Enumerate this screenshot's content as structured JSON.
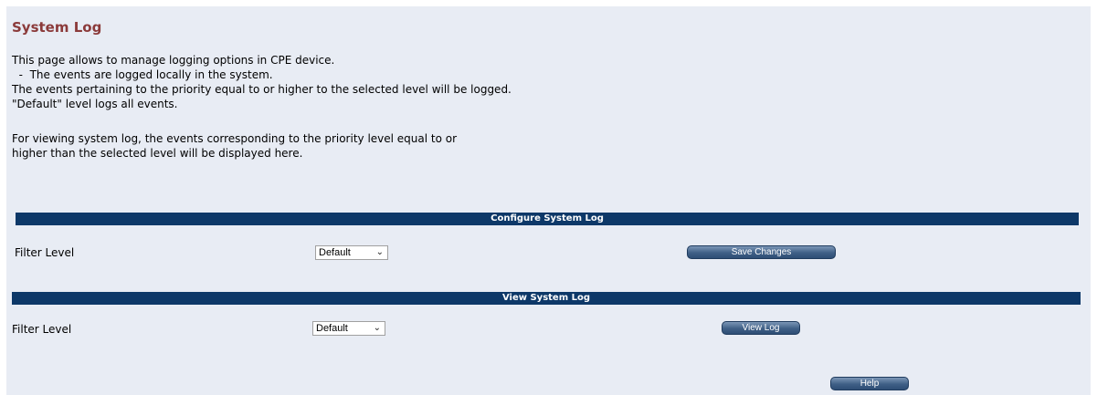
{
  "page": {
    "title": "System Log",
    "description": [
      "This page allows to manage logging options in CPE device.",
      "  -  The events are logged locally in the system.",
      "The events pertaining to the priority equal to or higher to the selected level will be logged.",
      "\"Default\" level logs all events."
    ],
    "viewing_note": [
      "For viewing system log, the events corresponding to the priority level equal to or",
      "higher than the selected level will be displayed here."
    ]
  },
  "configure_section": {
    "header": "Configure System Log",
    "filter_label": "Filter Level",
    "filter_value": "Default",
    "save_button": "Save Changes"
  },
  "view_section": {
    "header": "View System Log",
    "filter_label": "Filter Level",
    "filter_value": "Default",
    "view_button": "View Log"
  },
  "help_button": "Help",
  "icons": {
    "dropdown": "chevron-down-icon"
  },
  "colors": {
    "title": "#8b3a3a",
    "section_bar": "#0d3868",
    "panel_bg": "#e8ecf4"
  }
}
